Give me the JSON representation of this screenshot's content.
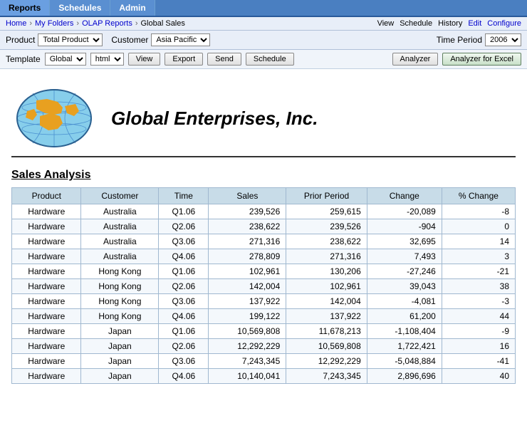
{
  "tabs": [
    {
      "label": "Reports",
      "active": true
    },
    {
      "label": "Schedules",
      "active": false
    },
    {
      "label": "Admin",
      "active": false
    }
  ],
  "breadcrumb": {
    "items": [
      "Home",
      "My Folders",
      "OLAP Reports",
      "Global Sales"
    ],
    "right_items": [
      "View",
      "Schedule",
      "History",
      "Edit",
      "Configure"
    ]
  },
  "filters": {
    "product_label": "Product",
    "product_value": "Total Product",
    "customer_label": "Customer",
    "customer_value": "Asia Pacific",
    "time_period_label": "Time Period",
    "time_period_value": "2006"
  },
  "toolbar": {
    "template_label": "Template",
    "template_value": "Global",
    "format_value": "html",
    "view_label": "View",
    "export_label": "Export",
    "send_label": "Send",
    "schedule_label": "Schedule",
    "analyzer_label": "Analyzer",
    "analyzer_excel_label": "Analyzer for Excel"
  },
  "report": {
    "company_name": "Global Enterprises, Inc.",
    "section_title": "Sales Analysis",
    "columns": [
      "Product",
      "Customer",
      "Time",
      "Sales",
      "Prior Period",
      "Change",
      "% Change"
    ],
    "rows": [
      [
        "Hardware",
        "Australia",
        "Q1.06",
        "239,526",
        "259,615",
        "-20,089",
        "-8"
      ],
      [
        "Hardware",
        "Australia",
        "Q2.06",
        "238,622",
        "239,526",
        "-904",
        "0"
      ],
      [
        "Hardware",
        "Australia",
        "Q3.06",
        "271,316",
        "238,622",
        "32,695",
        "14"
      ],
      [
        "Hardware",
        "Australia",
        "Q4.06",
        "278,809",
        "271,316",
        "7,493",
        "3"
      ],
      [
        "Hardware",
        "Hong Kong",
        "Q1.06",
        "102,961",
        "130,206",
        "-27,246",
        "-21"
      ],
      [
        "Hardware",
        "Hong Kong",
        "Q2.06",
        "142,004",
        "102,961",
        "39,043",
        "38"
      ],
      [
        "Hardware",
        "Hong Kong",
        "Q3.06",
        "137,922",
        "142,004",
        "-4,081",
        "-3"
      ],
      [
        "Hardware",
        "Hong Kong",
        "Q4.06",
        "199,122",
        "137,922",
        "61,200",
        "44"
      ],
      [
        "Hardware",
        "Japan",
        "Q1.06",
        "10,569,808",
        "11,678,213",
        "-1,108,404",
        "-9"
      ],
      [
        "Hardware",
        "Japan",
        "Q2.06",
        "12,292,229",
        "10,569,808",
        "1,722,421",
        "16"
      ],
      [
        "Hardware",
        "Japan",
        "Q3.06",
        "7,243,345",
        "12,292,229",
        "-5,048,884",
        "-41"
      ],
      [
        "Hardware",
        "Japan",
        "Q4.06",
        "10,140,041",
        "7,243,345",
        "2,896,696",
        "40"
      ]
    ]
  }
}
